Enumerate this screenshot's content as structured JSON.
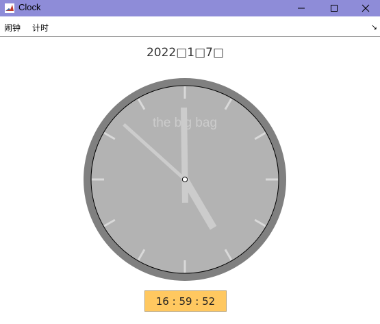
{
  "window": {
    "title": "Clock",
    "titlebar_color": "#8e8cd8",
    "controls": [
      "minimize-icon",
      "maximize-icon",
      "close-icon"
    ]
  },
  "menu": {
    "items": [
      {
        "label": "闹钟"
      },
      {
        "label": "计时"
      }
    ],
    "right_glyph": "↘"
  },
  "clock": {
    "date_text": "2022□1□7□",
    "face_text": "the big bag",
    "time": {
      "hour": 16,
      "minute": 59,
      "second": 52
    },
    "colors": {
      "rim": "#808080",
      "face": "#b3b3b3",
      "hands": "#cccccc",
      "ticks": "#d9d9d9"
    }
  },
  "time_display": {
    "text": "16 : 59 : 52",
    "background": "#ffc860"
  }
}
